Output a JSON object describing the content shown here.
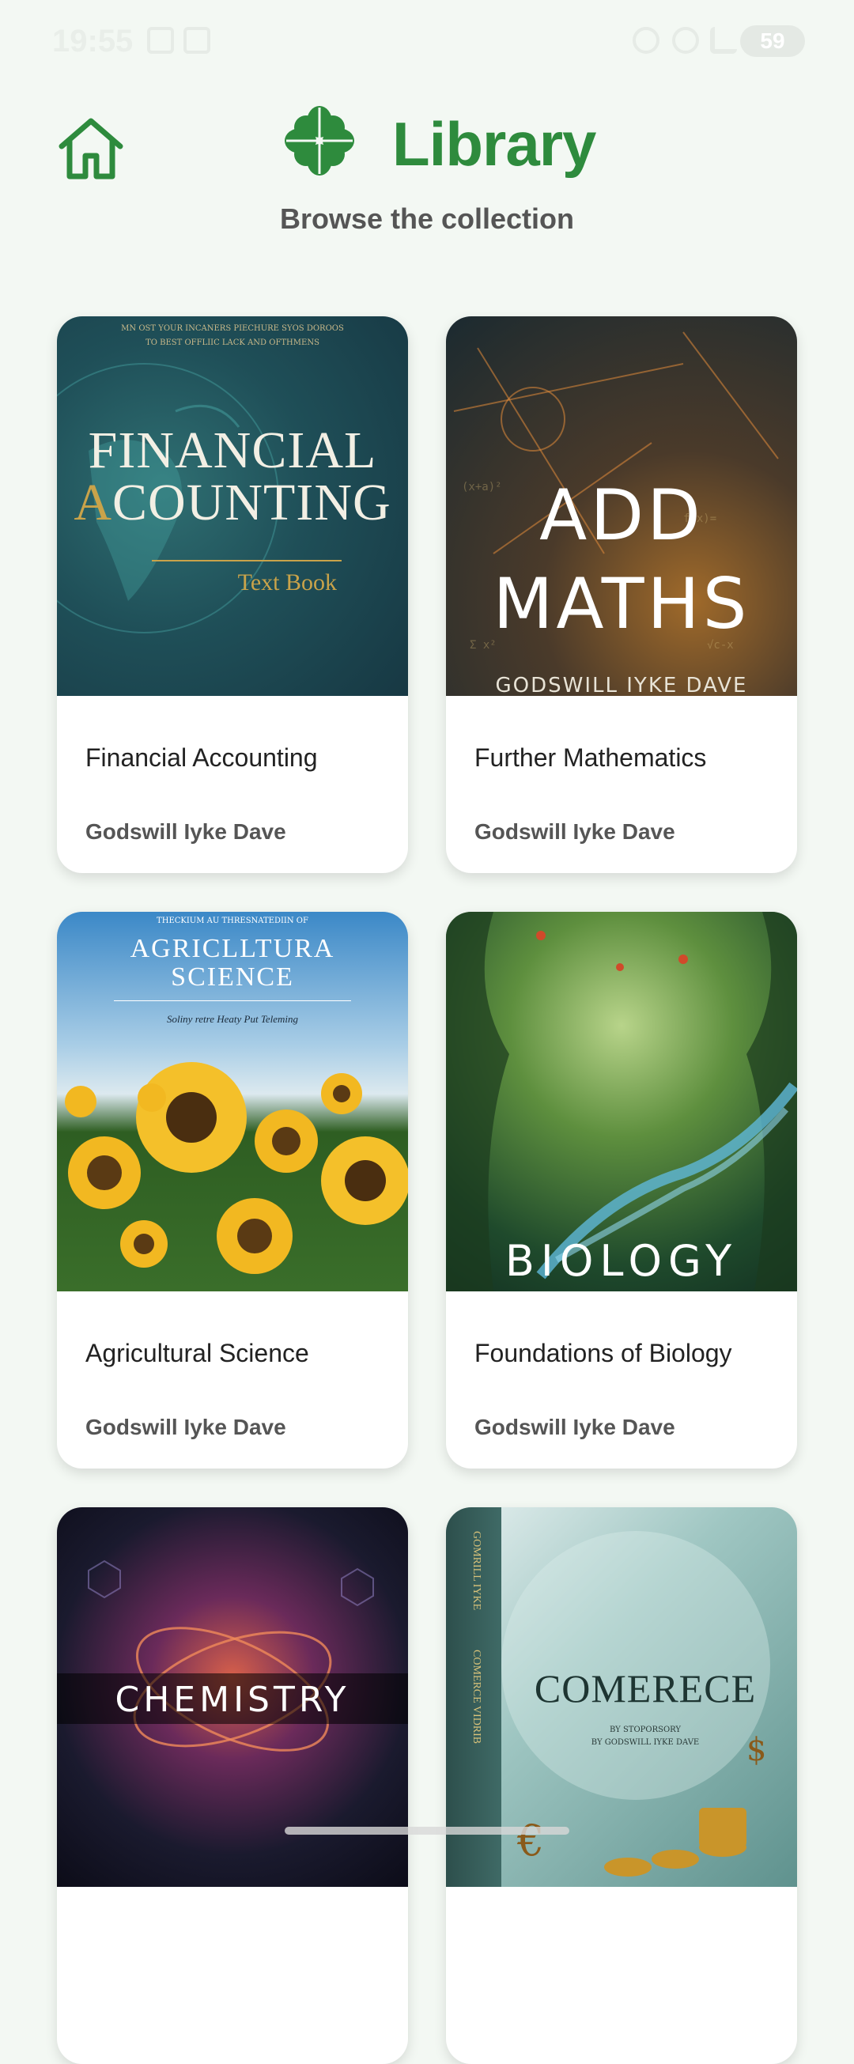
{
  "status_bar": {
    "time": "19:55",
    "battery": "59"
  },
  "header": {
    "title": "Library",
    "subtitle": "Browse the collection"
  },
  "icons": {
    "home": "home-icon",
    "logo": "clover-icon"
  },
  "colors": {
    "accent": "#2e8b3d",
    "background": "#f3f8f3"
  },
  "books": [
    {
      "title": "Financial Accounting",
      "author": "Godswill Iyke Dave",
      "cover": {
        "top_line_1": "MN OST YOUR INCANERS PIECHURE SYOS DOROOS",
        "top_line_2": "TO BEST OFFLIIC LACK AND OFTHMENS",
        "line_1": "FINANCIAL",
        "line_2_accent": "A",
        "line_2": "COUNTING",
        "sub": "Text Book"
      }
    },
    {
      "title": "Further Mathematics",
      "author": "Godswill Iyke Dave",
      "cover": {
        "line_1": "ADD",
        "line_2": "MATHS",
        "author_line": "GODSWILL IYKE DAVE"
      }
    },
    {
      "title": "Agricultural Science",
      "author": "Godswill Iyke Dave",
      "cover": {
        "top_line": "THECKIUM AU THRESNATEDIIN OF",
        "line_1": "AGRICLLTURA",
        "line_2": "SCIENCE",
        "sub": "Soliny retre Heaty Put Teleming"
      }
    },
    {
      "title": "Foundations of Biology",
      "author": "Godswill Iyke Dave",
      "cover": {
        "line_1": "BIOLOGY"
      }
    },
    {
      "title": "",
      "author": "",
      "cover": {
        "line_1": "CHEMISTRY"
      }
    },
    {
      "title": "",
      "author": "",
      "cover": {
        "line_1": "COMERECE",
        "sub_1": "BY STOPORSORY",
        "sub_2": "BY GODSWILL IYKE DAVE",
        "spine_1": "GOMRILL IYKE",
        "spine_2": "COMERCE VIDRIB"
      }
    }
  ]
}
